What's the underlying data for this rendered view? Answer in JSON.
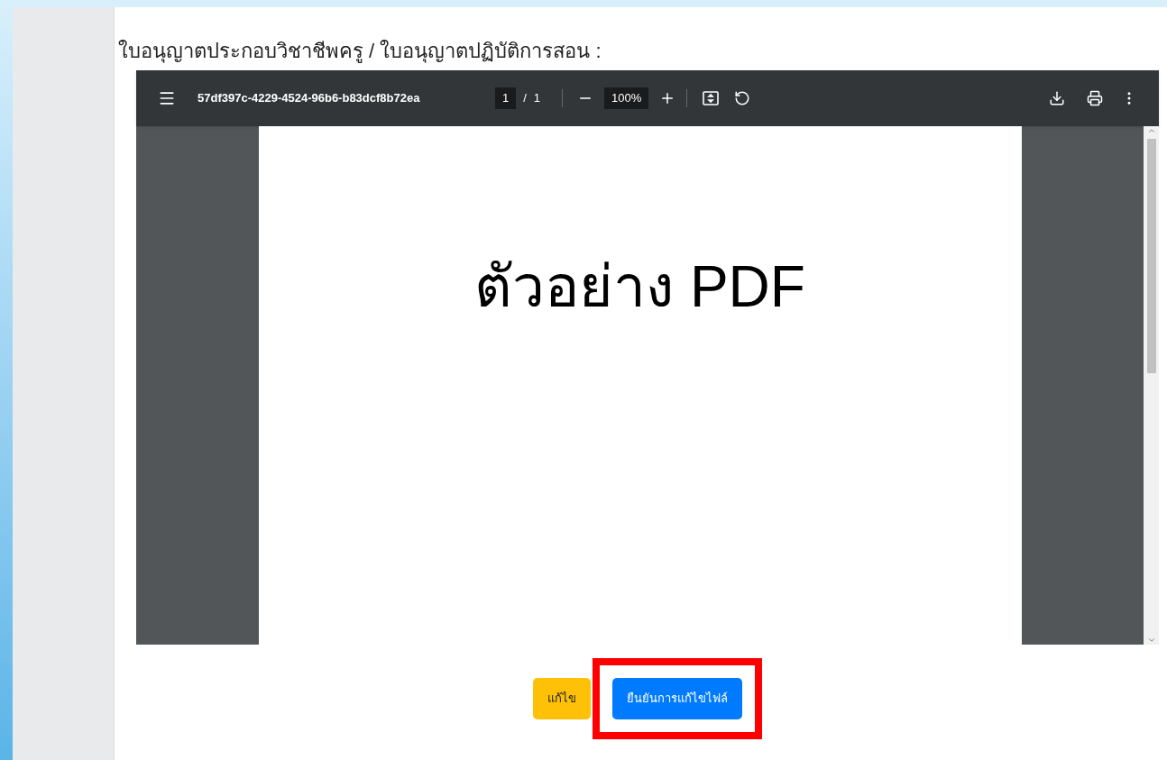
{
  "heading": "ใบอนุญาตประกอบวิชาชีพครู / ใบอนุญาตปฏิบัติการสอน :",
  "viewer": {
    "file_name": "57df397c-4229-4524-96b6-b83dcf8b72ea",
    "page": "1",
    "page_sep": "/",
    "page_total": "1",
    "zoom": "100%",
    "page_text": "ตัวอย่าง PDF"
  },
  "buttons": [
    {
      "kind": "warning",
      "label": "แก้ไข",
      "highlighted": false
    },
    {
      "kind": "primary",
      "label": "ยืนยันการแก้ไขไฟล์",
      "highlighted": true
    }
  ]
}
